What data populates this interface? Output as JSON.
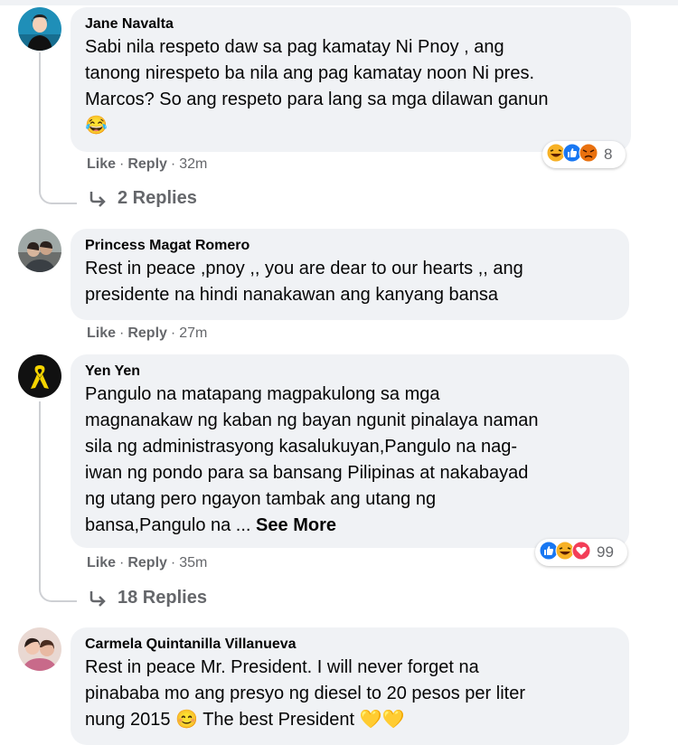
{
  "comments": [
    {
      "author": "Jane Navalta",
      "text_lines": [
        "Sabi nila respeto daw sa pag kamatay Ni Pnoy , ang",
        "tanong nirespeto ba nila ang pag kamatay noon Ni pres.",
        "Marcos? So ang respeto para lang sa mga dilawan ganun"
      ],
      "emoji": "😂",
      "like_label": "Like",
      "reply_label": "Reply",
      "time": "32m",
      "reaction_icons": [
        "haha-icon",
        "like-icon",
        "angry-icon"
      ],
      "reaction_count": "8",
      "replies_label": "2 Replies"
    },
    {
      "author": "Princess Magat Romero",
      "text_lines": [
        "Rest in peace ,pnoy ,, you are dear to our hearts ,, ang",
        "presidente na hindi nanakawan ang kanyang bansa"
      ],
      "like_label": "Like",
      "reply_label": "Reply",
      "time": "27m"
    },
    {
      "author": "Yen Yen",
      "text_lines": [
        "Pangulo na matapang magpakulong sa mga",
        "magnanakaw ng kaban ng bayan ngunit pinalaya naman",
        "sila ng administrasyong kasalukuyan,Pangulo na nag-",
        "iwan ng pondo para sa bansang Pilipinas at nakabayad",
        "ng utang pero ngayon tambak ang utang ng",
        "bansa,Pangulo na ..."
      ],
      "see_more": "See More",
      "like_label": "Like",
      "reply_label": "Reply",
      "time": "35m",
      "reaction_icons": [
        "like-icon",
        "haha-icon",
        "love-icon"
      ],
      "reaction_count": "99",
      "replies_label": "18 Replies"
    },
    {
      "author": "Carmela Quintanilla Villanueva",
      "text_lines": [
        "Rest in peace Mr. President. I will never forget na",
        "pinababa mo ang presyo ng diesel to 20 pesos per liter",
        "nung 2015 😊 The best President 💛💛"
      ]
    }
  ],
  "colors": {
    "bubble": "#f0f2f5",
    "meta": "#65676b",
    "like": "#1877f2",
    "love": "#f33e58",
    "haha": "#f7b125",
    "angry": "#e9710f"
  }
}
